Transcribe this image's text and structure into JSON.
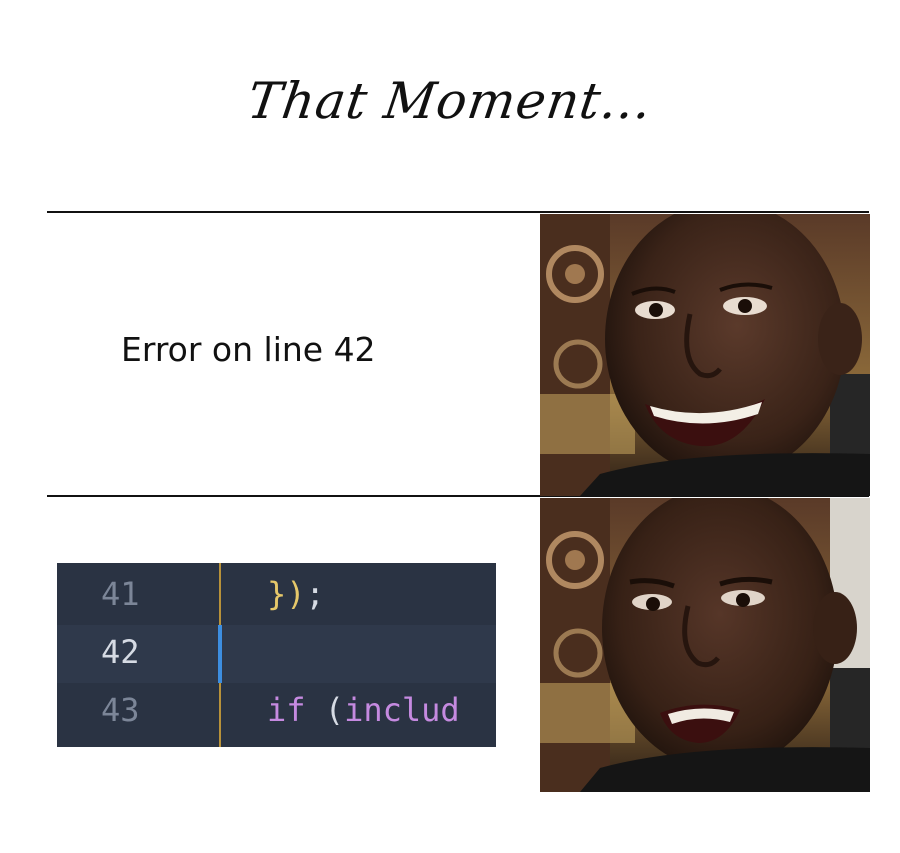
{
  "title": "That Moment...",
  "panel_top": {
    "caption": "Error on line 42"
  },
  "panel_bottom": {
    "code": {
      "lines": [
        {
          "number": "41",
          "parts": [
            "})",
            ";"
          ]
        },
        {
          "number": "42",
          "parts": []
        },
        {
          "number": "43",
          "parts": [
            "if",
            " (",
            "includ"
          ]
        }
      ]
    }
  },
  "images": {
    "top": "man-smiling-photo",
    "bottom": "man-disappointed-photo"
  },
  "colors": {
    "code_bg": "#2a3343",
    "gutter": "#b8923a",
    "cursor": "#3d8ee0",
    "keyword": "#c58ae0",
    "brace": "#e6c86a"
  }
}
